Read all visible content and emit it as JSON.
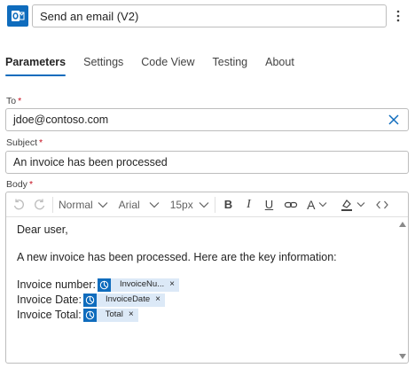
{
  "header": {
    "app_icon": "outlook-icon",
    "title": "Send an email (V2)",
    "more_icon": "more-vertical-icon"
  },
  "tabs": [
    {
      "label": "Parameters",
      "active": true
    },
    {
      "label": "Settings",
      "active": false
    },
    {
      "label": "Code View",
      "active": false
    },
    {
      "label": "Testing",
      "active": false
    },
    {
      "label": "About",
      "active": false
    }
  ],
  "fields": {
    "to": {
      "label": "To",
      "required_mark": "*",
      "value": "jdoe@contoso.com",
      "clear_icon": "close-icon"
    },
    "subject": {
      "label": "Subject",
      "required_mark": "*",
      "value": "An invoice has been processed"
    },
    "body": {
      "label": "Body",
      "required_mark": "*"
    }
  },
  "toolbar": {
    "paragraph_style": "Normal",
    "font": "Arial",
    "font_size": "15px",
    "icons": [
      "undo-icon",
      "redo-icon",
      "bold-icon",
      "italic-icon",
      "underline-icon",
      "link-icon",
      "font-color-icon",
      "highlight-icon",
      "code-view-icon"
    ]
  },
  "body": {
    "greeting": "Dear user,",
    "intro": "A new invoice has been processed. Here are the key information:",
    "rows": [
      {
        "label": "Invoice number:",
        "token": "InvoiceNu..."
      },
      {
        "label": "Invoice Date:",
        "token": "InvoiceDate"
      },
      {
        "label": "Invoice Total:",
        "token": "Total"
      }
    ]
  },
  "colors": {
    "accent": "#0F6CBD",
    "required": "#c50f1f",
    "token_bg": "#dce9f7",
    "border": "#bdbdbd"
  }
}
